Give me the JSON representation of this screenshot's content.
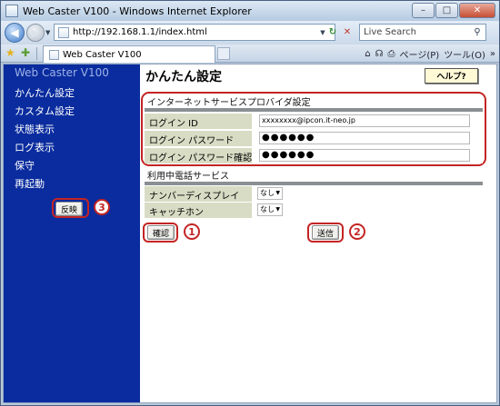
{
  "window": {
    "title": "Web Caster V100 - Windows Internet Explorer",
    "controls": {
      "minimize": "–",
      "maximize": "□",
      "close": "✕"
    }
  },
  "address_bar": {
    "url": "http://192.168.1.1/index.html",
    "search_placeholder": "Live Search"
  },
  "tab": {
    "label": "Web Caster V100"
  },
  "command_bar": {
    "home_icon": "⌂",
    "feeds_icon": "☊",
    "print_icon": "⎙",
    "page_label": "ページ(P)",
    "tools_label": "ツール(O)",
    "more": "»"
  },
  "sidebar": {
    "brand": "Web Caster V100",
    "items": [
      {
        "label": "かんたん設定"
      },
      {
        "label": "カスタム設定"
      },
      {
        "label": "状態表示"
      },
      {
        "label": "ログ表示"
      },
      {
        "label": "保守"
      },
      {
        "label": "再起動"
      }
    ],
    "reflect_button": "反映",
    "reflect_marker": "3"
  },
  "main": {
    "title": "かんたん設定",
    "help_button": "ヘルプ?",
    "isp_section": {
      "title": "インターネットサービスプロバイダ設定",
      "rows": [
        {
          "label": "ログイン ID",
          "value": "xxxxxxxx@ipcon.it-neo.jp"
        },
        {
          "label": "ログイン パスワード",
          "value": "●●●●●●"
        },
        {
          "label": "ログイン パスワード確認",
          "value": "●●●●●●"
        }
      ]
    },
    "phone_section": {
      "title": "利用中電話サービス",
      "rows": [
        {
          "label": "ナンバーディスプレイ",
          "value": "なし"
        },
        {
          "label": "キャッチホン",
          "value": "なし"
        }
      ]
    },
    "confirm_button": "確認",
    "confirm_marker": "1",
    "send_button": "送信",
    "send_marker": "2"
  },
  "colors": {
    "sidebar_bg": "#0a2c9e",
    "row_label_bg": "#d8dcc4",
    "highlight": "#c42424"
  }
}
